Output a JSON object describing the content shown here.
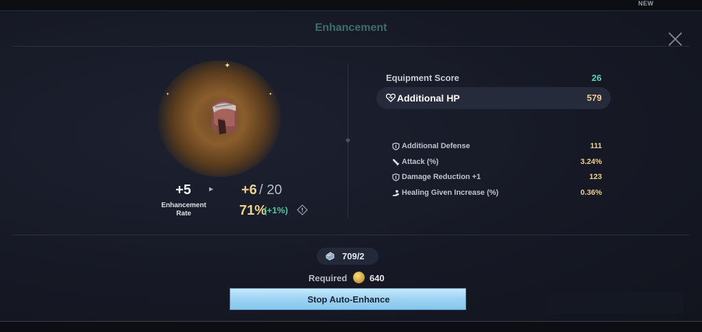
{
  "topbar": {
    "new_badge": "NEW"
  },
  "dialog": {
    "title": "Enhancement"
  },
  "enhance": {
    "current_level": "+5",
    "next_level": "+6",
    "max_level": "/ 20",
    "rate_label": "Enhancement Rate",
    "rate_value": "71%",
    "rate_bonus": "(+1%)"
  },
  "stats": {
    "score_label": "Equipment Score",
    "score_value": "26",
    "main_label": "Additional HP",
    "main_value": "579",
    "sub": [
      {
        "icon": "shield-icon",
        "label": "Additional Defense",
        "value": "111"
      },
      {
        "icon": "sword-icon",
        "label": "Attack (%)",
        "value": "3.24%"
      },
      {
        "icon": "shield-icon",
        "label": "Damage Reduction +1",
        "value": "123"
      },
      {
        "icon": "healing-hand-icon",
        "label": "Healing Given Increase (%)",
        "value": "0.36%"
      }
    ]
  },
  "cost": {
    "material_value": "709/2",
    "required_label": "Required",
    "gold_value": "640"
  },
  "actions": {
    "stop_auto_label": "Stop Auto-Enhance"
  },
  "colors": {
    "accent_gold": "#efcf8f",
    "accent_teal": "#5ed1c0",
    "bonus_green": "#4fc7a3",
    "button_blue": "#9bd3f4"
  }
}
